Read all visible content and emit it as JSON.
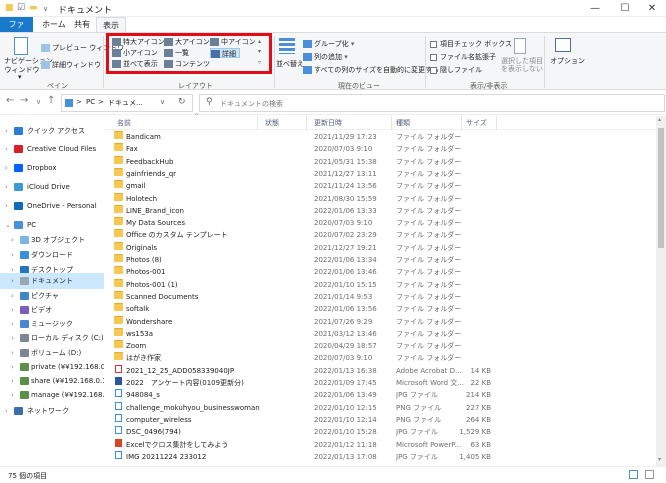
{
  "titlebar": {
    "title": "ドキュメント",
    "qa_check": "☑",
    "qa_folder": "▬",
    "qa_caret": "∨",
    "minimize": "—",
    "maximize": "☐",
    "close": "✕"
  },
  "tabs": [
    "ファイル",
    "ホーム",
    "共有",
    "表示"
  ],
  "ribbon": {
    "navpane_label": "ナビゲーション\nウィンドウ",
    "navpane_caret": "▾",
    "preview_pane": "プレビュー ウィンドウ",
    "details_pane": "詳細ウィンドウ",
    "pane_group": "ペイン",
    "layout_items": [
      "特大アイコン",
      "大アイコン",
      "中アイコン",
      "小アイコン",
      "一覧",
      "詳細",
      "並べて表示",
      "コンテンツ"
    ],
    "layout_group": "レイアウト",
    "sort_by": "並べ替え",
    "group_by": "グループ化",
    "add_column": "列の追加",
    "fit_columns": "すべての列のサイズを自動的に変更する",
    "current_view_group": "現在のビュー",
    "item_checkboxes": "項目チェック ボックス",
    "file_extensions": "ファイル名拡張子",
    "hidden_items": "隠しファイル",
    "hide_selected": "選択した項目を表示しない",
    "options": "オプション",
    "showhide_group": "表示/非表示"
  },
  "address": {
    "path_root": "PC",
    "path_sep": ">",
    "path_current": "ドキュメ...",
    "search_placeholder": "ドキュメントの検索",
    "back": "←",
    "forward": "→",
    "recent": "∨",
    "up": "↑",
    "dropdown": "∨",
    "refresh": "↻",
    "search_glyph": "⚲"
  },
  "sidebar": {
    "items": [
      {
        "label": "クイック アクセス",
        "color": "#2b7cd3"
      },
      {
        "label": "Creative Cloud Files",
        "color": "#da1f26"
      },
      {
        "label": "Dropbox",
        "color": "#0061fe"
      },
      {
        "label": "iCloud Drive",
        "color": "#3b9bd9"
      },
      {
        "label": "OneDrive - Personal",
        "color": "#0f6cbd"
      },
      {
        "label": "PC",
        "color": "#4a90d9"
      },
      {
        "label": "3D オブジェクト",
        "color": "#7ab5e3"
      },
      {
        "label": "ダウンロード",
        "color": "#3a8fd6"
      },
      {
        "label": "デスクトップ",
        "color": "#2574be"
      },
      {
        "label": "ドキュメント",
        "color": "#9aa6b2"
      },
      {
        "label": "ピクチャ",
        "color": "#3f88c8"
      },
      {
        "label": "ビデオ",
        "color": "#7a5fb8"
      },
      {
        "label": "ミュージック",
        "color": "#4a86cf"
      },
      {
        "label": "ローカル ディスク (C:)",
        "color": "#7d8794"
      },
      {
        "label": "ボリューム (D:)",
        "color": "#7d8794"
      },
      {
        "label": "private (¥¥192.168.0.100)",
        "color": "#5c8f4a"
      },
      {
        "label": "share (¥¥192.168.0.100)",
        "color": "#5c8f4a"
      },
      {
        "label": "manage (¥¥192.168.0.100)",
        "color": "#5c8f4a"
      },
      {
        "label": "ネットワーク",
        "color": "#3a6fa8"
      }
    ]
  },
  "columns": {
    "name": "名前",
    "status": "状態",
    "date": "更新日時",
    "type": "種類",
    "size": "サイズ",
    "sort_arrow": "^"
  },
  "files": [
    {
      "name": "Bandicam",
      "date": "2021/11/29 17:23",
      "type": "ファイル フォルダー",
      "size": "",
      "icon": "folder"
    },
    {
      "name": "Fax",
      "date": "2020/07/03 9:10",
      "type": "ファイル フォルダー",
      "size": "",
      "icon": "folder"
    },
    {
      "name": "FeedbackHub",
      "date": "2021/05/31 15:38",
      "type": "ファイル フォルダー",
      "size": "",
      "icon": "folder"
    },
    {
      "name": "gainfriends_qr",
      "date": "2021/12/27 13:11",
      "type": "ファイル フォルダー",
      "size": "",
      "icon": "folder"
    },
    {
      "name": "gmail",
      "date": "2021/11/24 13:56",
      "type": "ファイル フォルダー",
      "size": "",
      "icon": "folder"
    },
    {
      "name": "Holotech",
      "date": "2021/08/30 15:59",
      "type": "ファイル フォルダー",
      "size": "",
      "icon": "folder"
    },
    {
      "name": "LINE_Brand_icon",
      "date": "2022/01/06 13:33",
      "type": "ファイル フォルダー",
      "size": "",
      "icon": "folder"
    },
    {
      "name": "My Data Sources",
      "date": "2020/07/03 9:10",
      "type": "ファイル フォルダー",
      "size": "",
      "icon": "folder"
    },
    {
      "name": "Office のカスタム テンプレート",
      "date": "2020/07/02 23:29",
      "type": "ファイル フォルダー",
      "size": "",
      "icon": "folder"
    },
    {
      "name": "Originals",
      "date": "2021/12/27 19:21",
      "type": "ファイル フォルダー",
      "size": "",
      "icon": "folder"
    },
    {
      "name": "Photos (8)",
      "date": "2022/01/06 13:34",
      "type": "ファイル フォルダー",
      "size": "",
      "icon": "folder"
    },
    {
      "name": "Photos-001",
      "date": "2022/01/06 13:46",
      "type": "ファイル フォルダー",
      "size": "",
      "icon": "folder"
    },
    {
      "name": "Photos-001 (1)",
      "date": "2022/01/10 15:15",
      "type": "ファイル フォルダー",
      "size": "",
      "icon": "folder"
    },
    {
      "name": "Scanned Documents",
      "date": "2021/01/14 9:53",
      "type": "ファイル フォルダー",
      "size": "",
      "icon": "folder"
    },
    {
      "name": "softalk",
      "date": "2022/01/06 13:56",
      "type": "ファイル フォルダー",
      "size": "",
      "icon": "folder"
    },
    {
      "name": "Wondershare",
      "date": "2021/07/26 9:29",
      "type": "ファイル フォルダー",
      "size": "",
      "icon": "folder"
    },
    {
      "name": "ws153a",
      "date": "2021/03/12 13:46",
      "type": "ファイル フォルダー",
      "size": "",
      "icon": "folder"
    },
    {
      "name": "Zoom",
      "date": "2020/04/29 18:57",
      "type": "ファイル フォルダー",
      "size": "",
      "icon": "folder"
    },
    {
      "name": "はがき作家",
      "date": "2020/07/03 9:10",
      "type": "ファイル フォルダー",
      "size": "",
      "icon": "folder"
    },
    {
      "name": "2021_12_25_ADD058339040JP",
      "date": "2022/01/13 16:38",
      "type": "Adobe Acrobat D...",
      "size": "14 KB",
      "icon": "pdf"
    },
    {
      "name": "2022　アンケート内容(0109更新分)",
      "date": "2022/01/09 17:45",
      "type": "Microsoft Word 文...",
      "size": "22 KB",
      "icon": "doc"
    },
    {
      "name": "948084_s",
      "date": "2022/01/06 13:49",
      "type": "JPG ファイル",
      "size": "214 KB",
      "icon": "img"
    },
    {
      "name": "challenge_mokuhyou_businesswoman",
      "date": "2022/01/10 12:15",
      "type": "PNG ファイル",
      "size": "227 KB",
      "icon": "img"
    },
    {
      "name": "computer_wireless",
      "date": "2022/01/10 12:14",
      "type": "PNG ファイル",
      "size": "264 KB",
      "icon": "img"
    },
    {
      "name": "DSC_0496(794)",
      "date": "2022/01/10 15:28",
      "type": "JPG ファイル",
      "size": "1,529 KB",
      "icon": "img"
    },
    {
      "name": "Excelでクロス集計をしてみよう",
      "date": "2022/01/12 11:18",
      "type": "Microsoft PowerP...",
      "size": "63 KB",
      "icon": "ppt"
    },
    {
      "name": "IMG 20211224 233012",
      "date": "2022/01/13 17:08",
      "type": "JPG ファイル",
      "size": "1,405 KB",
      "icon": "img"
    }
  ],
  "status": {
    "count": "75 個の項目"
  },
  "accent": "#1979ca",
  "highlight_border": "#e30b17"
}
